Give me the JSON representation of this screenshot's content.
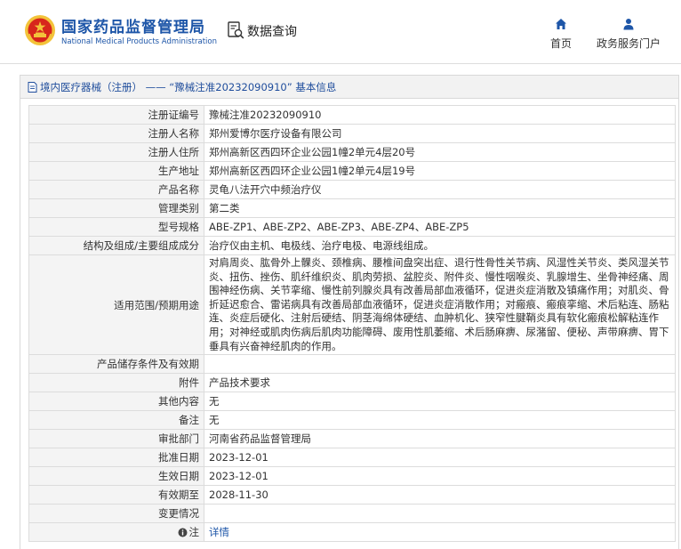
{
  "header": {
    "brand_cn": "国家药品监督管理局",
    "brand_en": "National Medical Products Administration",
    "query_label": "数据查询",
    "nav": [
      {
        "label": "首页",
        "icon": "home-icon"
      },
      {
        "label": "政务服务门户",
        "icon": "user-icon"
      }
    ]
  },
  "breadcrumb": {
    "icon": "document-icon",
    "text": "境内医疗器械（注册） —— “豫械注准20232090910” 基本信息"
  },
  "record": [
    {
      "label": "注册证编号",
      "value": "豫械注准20232090910"
    },
    {
      "label": "注册人名称",
      "value": "郑州爱博尔医疗设备有限公司"
    },
    {
      "label": "注册人住所",
      "value": "郑州高新区西四环企业公园1幢2单元4层20号"
    },
    {
      "label": "生产地址",
      "value": "郑州高新区西四环企业公园1幢2单元4层19号"
    },
    {
      "label": "产品名称",
      "value": "灵龟八法开穴中频治疗仪"
    },
    {
      "label": "管理类别",
      "value": "第二类"
    },
    {
      "label": "型号规格",
      "value": "ABE-ZP1、ABE-ZP2、ABE-ZP3、ABE-ZP4、ABE-ZP5"
    },
    {
      "label": "结构及组成/主要组成成分",
      "value": "治疗仪由主机、电极线、治疗电极、电源线组成。"
    },
    {
      "label": "适用范围/预期用途",
      "value": "对肩周炎、肱骨外上髁炎、颈椎病、腰椎间盘突出症、退行性骨性关节病、风湿性关节炎、类风湿关节炎、扭伤、挫伤、肌纤维织炎、肌肉劳损、盆腔炎、附件炎、慢性咽喉炎、乳腺增生、坐骨神经痛、周围神经伤病、关节挛缩、慢性前列腺炎具有改善局部血液循环，促进炎症消散及镇痛作用；对肌炎、骨折延迟愈合、雷诺病具有改善局部血液循环，促进炎症消散作用；对瘢痕、瘢痕挛缩、术后粘连、肠粘连、炎症后硬化、注射后硬结、阴茎海绵体硬结、血肿机化、狭窄性腱鞘炎具有软化瘢痕松解粘连作用；对神经或肌肉伤病后肌肉功能障碍、废用性肌萎缩、术后肠麻痹、尿潴留、便秘、声带麻痹、胃下垂具有兴奋神经肌肉的作用。",
      "multiline": true
    },
    {
      "label": "产品储存条件及有效期",
      "value": ""
    },
    {
      "label": "附件",
      "value": "产品技术要求"
    },
    {
      "label": "其他内容",
      "value": "无"
    },
    {
      "label": "备注",
      "value": "无"
    },
    {
      "label": "审批部门",
      "value": "河南省药品监督管理局"
    },
    {
      "label": "批准日期",
      "value": "2023-12-01"
    },
    {
      "label": "生效日期",
      "value": "2023-12-01"
    },
    {
      "label": "有效期至",
      "value": "2028-11-30"
    },
    {
      "label": "变更情况",
      "value": ""
    },
    {
      "label": "注",
      "value": "详情",
      "link": true,
      "icon": "info-icon"
    }
  ],
  "colors": {
    "brand_blue": "#1e56a8",
    "emblem_red": "#d7261c",
    "label_bg": "#f4f4f4"
  }
}
